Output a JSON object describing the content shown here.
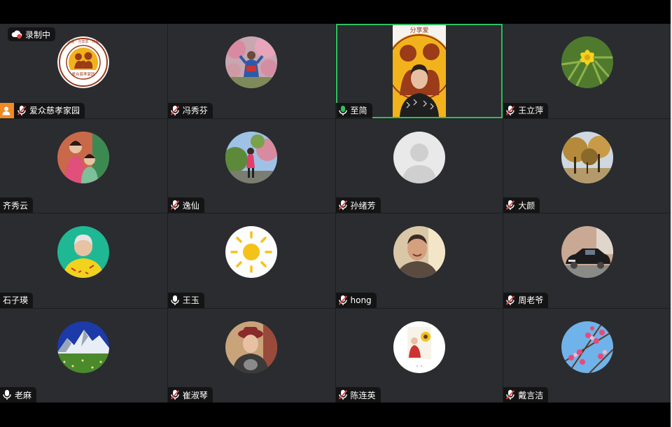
{
  "recording": {
    "label": "录制中"
  },
  "colors": {
    "active_border": "#2fbf5f",
    "host_badge": "#f08a24",
    "tile_bg": "#2a2c30",
    "muted_red": "#e04545"
  },
  "participants": [
    {
      "name": "爱众慈孝家园",
      "mic": "muted",
      "host": true,
      "avatar": "logo-avatar"
    },
    {
      "name": "冯秀芬",
      "mic": "muted",
      "avatar": "blossom-photo-avatar"
    },
    {
      "name": "至简",
      "mic": "speaking",
      "video": true,
      "active": true
    },
    {
      "name": "王立萍",
      "mic": "muted",
      "avatar": "yellow-flower-avatar"
    },
    {
      "name": "齐秀云",
      "mic": "none",
      "avatar": "kids-photo-avatar"
    },
    {
      "name": "逸仙",
      "mic": "muted",
      "avatar": "park-photo-avatar"
    },
    {
      "name": "孙绪芳",
      "mic": "muted",
      "avatar": "default-person-avatar"
    },
    {
      "name": "大颜",
      "mic": "muted",
      "avatar": "autumn-trees-avatar"
    },
    {
      "name": "石子瑛",
      "mic": "none",
      "avatar": "portrait-yellow-avatar"
    },
    {
      "name": "王玉",
      "mic": "on",
      "avatar": "sun-drawing-avatar"
    },
    {
      "name": "hong",
      "mic": "muted",
      "avatar": "smiling-man-avatar"
    },
    {
      "name": "周老爷",
      "mic": "muted",
      "avatar": "black-car-avatar"
    },
    {
      "name": "老麻",
      "mic": "on",
      "avatar": "mountain-meadow-avatar"
    },
    {
      "name": "崔淑琴",
      "mic": "muted",
      "avatar": "woman-hat-avatar"
    },
    {
      "name": "陈连英",
      "mic": "muted",
      "avatar": "sunflower-card-avatar"
    },
    {
      "name": "戴言洁",
      "mic": "muted",
      "avatar": "peach-blossom-avatar"
    }
  ],
  "logo": {
    "ring_text": "成为爱 · 分享爱 · 传播爱",
    "inner_text": "爱众慈孝家园"
  }
}
